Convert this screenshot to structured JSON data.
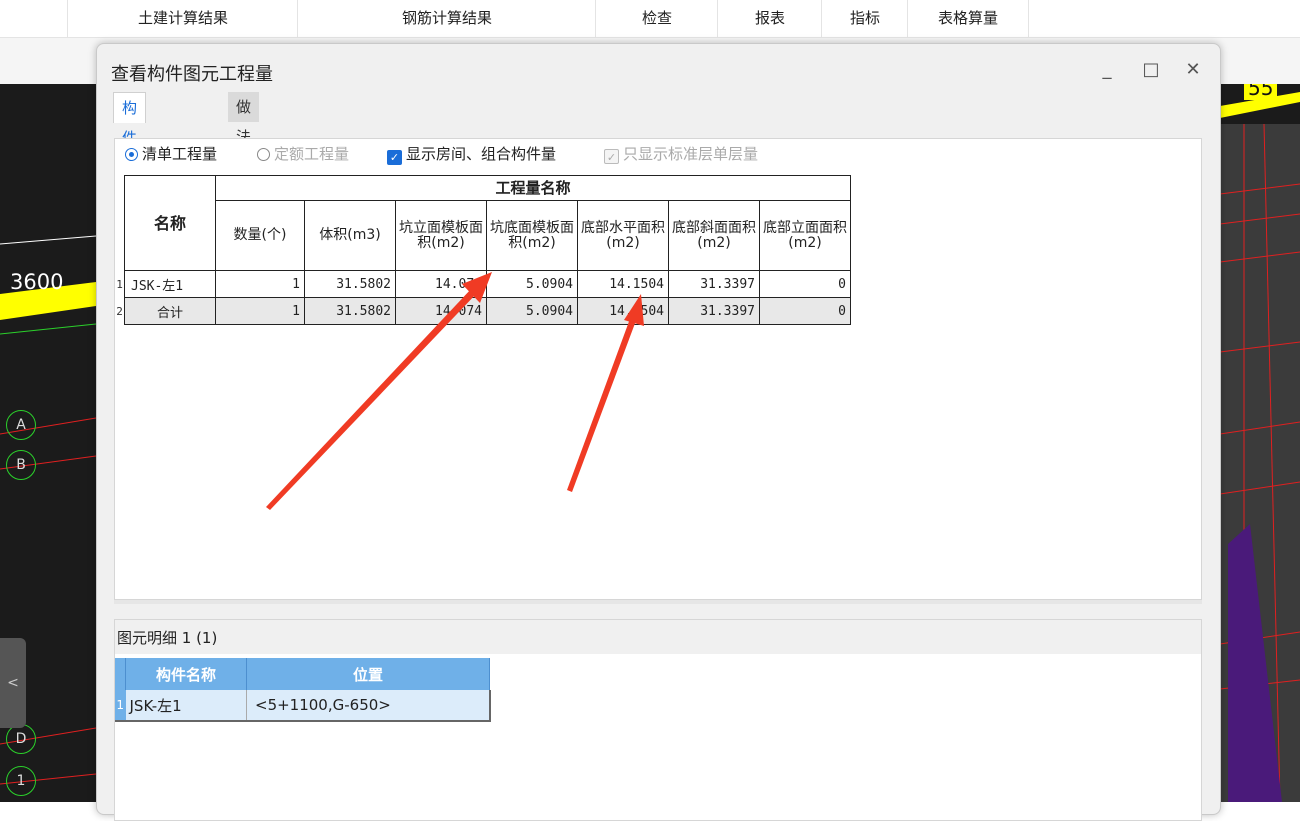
{
  "top_menu": {
    "tabs": [
      "土建计算结果",
      "钢筋计算结果",
      "检查",
      "报表",
      "指标",
      "表格算量"
    ]
  },
  "cad": {
    "dimension_left": "3600",
    "dimension_right": "55",
    "axis_labels": [
      "A",
      "B",
      "D",
      "1"
    ],
    "collapse_glyph": "<"
  },
  "dialog": {
    "title": "查看构件图元工程量",
    "window_buttons": {
      "minimize": "_",
      "maximize": "□",
      "close": "✕"
    },
    "tabs": [
      "构件工程量",
      "做法工程量"
    ],
    "options": {
      "radio_bill": "清单工程量",
      "radio_quota": "定额工程量",
      "show_rooms": "显示房间、组合构件量",
      "standard_floor_only": "只显示标准层单层量"
    },
    "grid": {
      "group_header": "工程量名称",
      "name_header": "名称",
      "columns": [
        "数量(个)",
        "体积(m3)",
        "坑立面模板面积(m2)",
        "坑底面模板面积(m2)",
        "底部水平面积(m2)",
        "底部斜面面积(m2)",
        "底部立面面积(m2)"
      ],
      "rows": [
        {
          "index": "1",
          "name": "JSK-左1",
          "values": [
            "1",
            "31.5802",
            "14.074",
            "5.0904",
            "14.1504",
            "31.3397",
            "0"
          ]
        },
        {
          "index": "2",
          "name": "合计",
          "values": [
            "1",
            "31.5802",
            "14.074",
            "5.0904",
            "14.1504",
            "31.3397",
            "0"
          ]
        }
      ]
    },
    "detail": {
      "title": "图元明细 1 (1)",
      "columns": [
        "构件名称",
        "位置"
      ],
      "rows": [
        {
          "index": "1",
          "name": "JSK-左1",
          "position": "<5+1100,G-650>"
        }
      ]
    }
  },
  "colors": {
    "accent": "#1a6dd8",
    "arrow": "#f03b24",
    "detail_header": "#6fb0e8",
    "cad_bg": "#1b1b1b"
  }
}
